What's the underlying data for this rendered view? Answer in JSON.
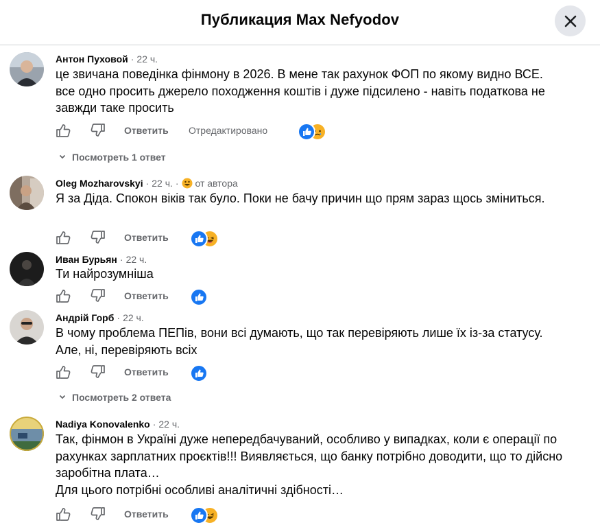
{
  "header": {
    "title": "Публикация Max Nefyodov"
  },
  "actions": {
    "like_icon": "like-icon",
    "dislike_icon": "dislike-icon",
    "reply_label": "Ответить"
  },
  "comments": [
    {
      "author": "Антон Пуховой",
      "time": "22 ч.",
      "text": "це звичана поведінка фінмону в 2026. В мене так рахунок ФОП по якому видно ВСЕ. все одно просить джерело походження коштів і дуже підсилено - навіть податкова не завжди таке просить",
      "edited": "Отредактировано",
      "reactions": [
        "like",
        "sad"
      ],
      "replies": "Посмотреть 1 ответ"
    },
    {
      "author": "Oleg Mozharovskyi",
      "time": "22 ч.",
      "badge": "от автора",
      "text": "Я за Діда. Спокон віків так було. Поки не бачу причин що прям зараз щось зміниться.",
      "reactions": [
        "like",
        "haha"
      ]
    },
    {
      "author": "Иван Бурьян",
      "time": "22 ч.",
      "text": "Ти найрозумніша",
      "reactions": [
        "like"
      ]
    },
    {
      "author": "Андрій Горб",
      "time": "22 ч.",
      "text": "В чому проблема ПЕПів, вони всі думають, що так перевіряють лише їх із-за статусу. Але, ні, перевіряють всіх",
      "reactions": [
        "like"
      ],
      "replies": "Посмотреть 2 ответа"
    },
    {
      "author": "Nadiya Konovalenko",
      "time": "22 ч.",
      "text": "Так, фінмон в Україні дуже непередбачуваний, особливо у випадках, коли є операції по рахунках зарплатних проєктів!!! Виявляється, що банку потрібно доводити, що то дійсно заробітна плата…",
      "text2": "Для цього потрібні особливі аналітичні здібності…",
      "reactions": [
        "like",
        "haha"
      ]
    }
  ],
  "colors": {
    "like_blue": "#1877f2",
    "secondary_text": "#65676b",
    "emoji_yellow": "#f7b125"
  }
}
